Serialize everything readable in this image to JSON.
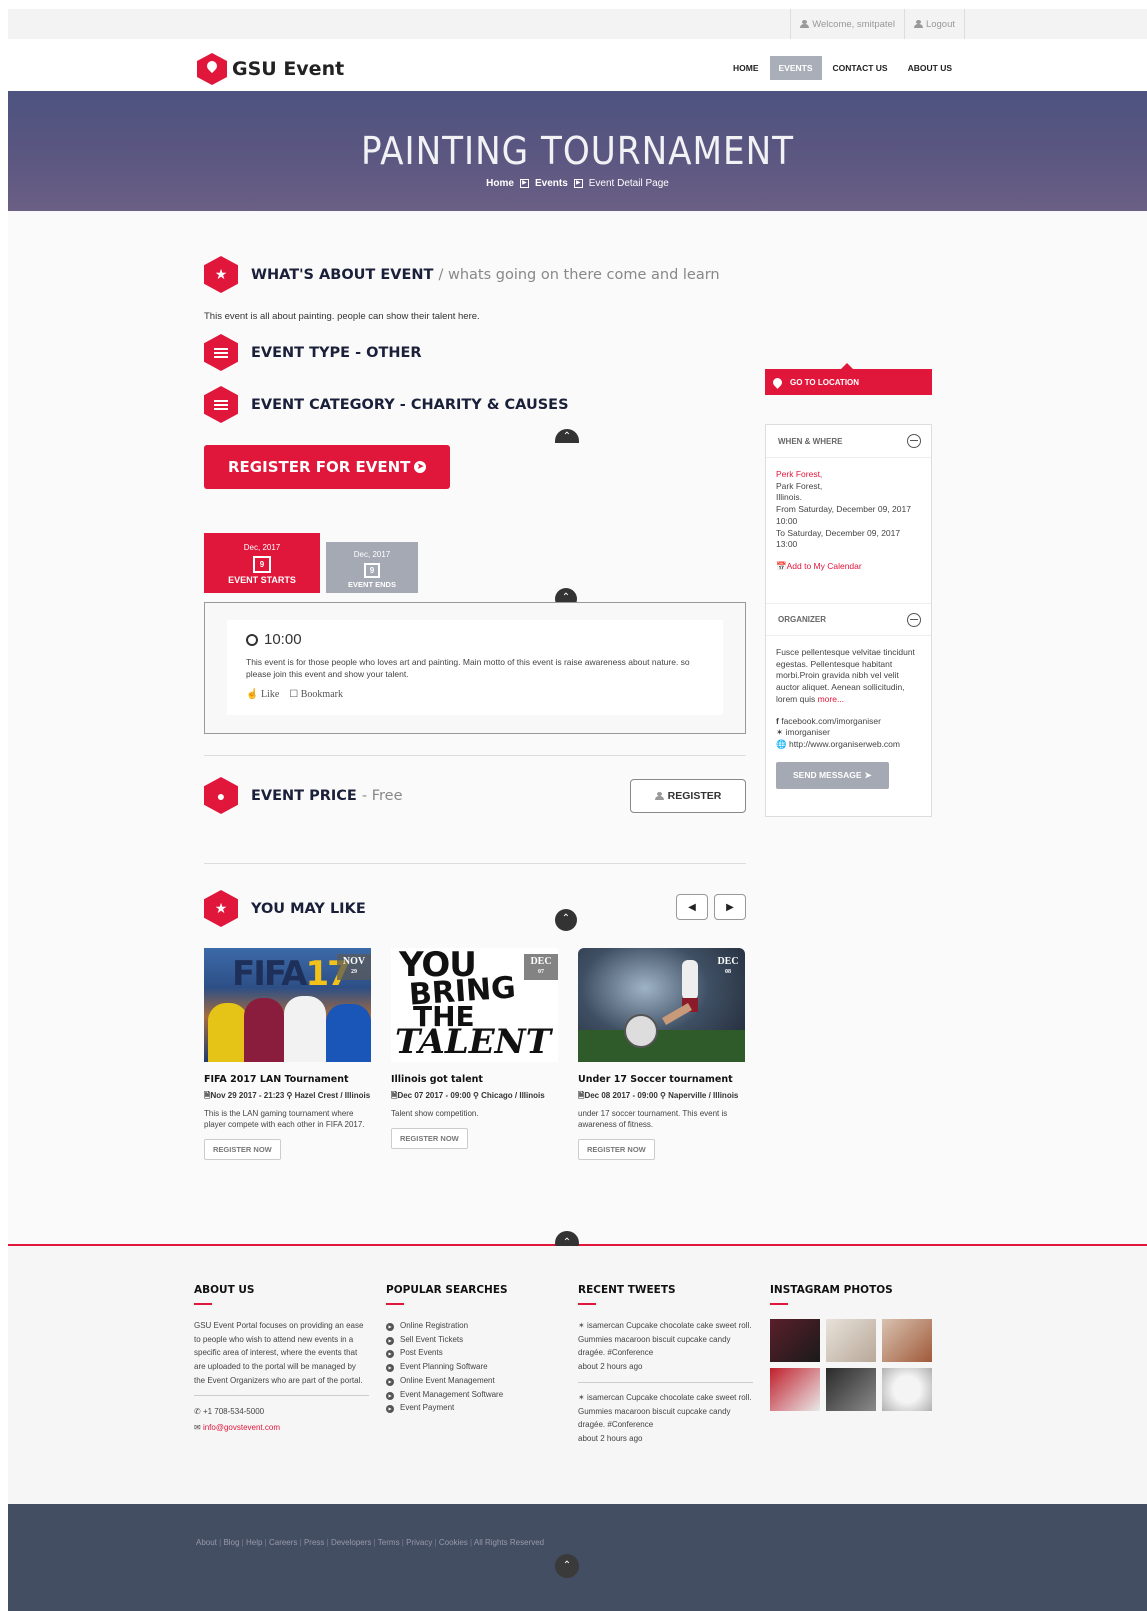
{
  "topbar": {
    "welcome": "Welcome, smitpatel",
    "logout": "Logout"
  },
  "brand": {
    "name": "GSU Event"
  },
  "nav": [
    {
      "label": "HOME"
    },
    {
      "label": "EVENTS"
    },
    {
      "label": "CONTACT US"
    },
    {
      "label": "ABOUT US"
    }
  ],
  "banner": {
    "title": "PAINTING TOURNAMENT",
    "crumb_home": "Home",
    "crumb_events": "Events",
    "crumb_current": "Event Detail Page"
  },
  "about": {
    "heading": "WHAT'S ABOUT EVENT",
    "subheading": "/ whats going on there come and learn",
    "description": "This event is all about painting. people can show their talent here."
  },
  "event_type": "EVENT TYPE - OTHER",
  "event_category": "EVENT CATEGORY - CHARITY & CAUSES",
  "register_button": "REGISTER FOR EVENT",
  "tabs": {
    "start": {
      "date": "Dec, 2017",
      "day": "9",
      "label": "EVENT STARTS"
    },
    "end": {
      "date": "Dec, 2017",
      "day": "9",
      "label": "EVENT ENDS"
    }
  },
  "schedule": {
    "time": "10:00",
    "text": "This event is for those people who loves art and painting. Main motto of this event is raise awareness about nature. so please join this event and show your talent.",
    "like": "Like",
    "bookmark": "Bookmark"
  },
  "price": {
    "label": "EVENT PRICE",
    "value": "- Free",
    "register": "REGISTER"
  },
  "you_may_like": {
    "heading": "YOU MAY LIKE",
    "cards": [
      {
        "badge_month": "NOV",
        "badge_day": "29",
        "title": "FIFA 2017 LAN Tournament",
        "meta": "Nov 29 2017 - 21:23 ⚲ Hazel Crest / Illinois",
        "desc": "This is the LAN gaming tournament where player compete with each other in FIFA 2017.",
        "button": "REGISTER NOW"
      },
      {
        "badge_month": "DEC",
        "badge_day": "07",
        "title": "Illinois got talent",
        "meta": "Dec 07 2017 - 09:00 ⚲ Chicago / Illinois",
        "desc": "Talent show competition.",
        "button": "REGISTER NOW"
      },
      {
        "badge_month": "DEC",
        "badge_day": "08",
        "title": "Under 17 Soccer tournament",
        "meta": "Dec 08 2017 - 09:00 ⚲ Naperville / Illinois",
        "desc": "under 17 soccer tournament. This event is awareness of fitness.",
        "button": "REGISTER NOW"
      }
    ]
  },
  "sidebar": {
    "location_button": "GO TO LOCATION",
    "when_where": {
      "heading": "WHEN & WHERE",
      "venue": "Perk Forest,",
      "city": "Park Forest,",
      "state": "Illinois.",
      "from": "From Saturday, December 09, 2017 10:00",
      "to": "To Saturday, December 09, 2017 13:00",
      "calendar": "Add to My Calendar"
    },
    "organizer": {
      "heading": "ORGANIZER",
      "text": "Fusce pellentesque velvitae tincidunt egestas. Pellentesque habitant morbi.Proin gravida nibh vel velit auctor aliquet. Aenean sollicitudin, lorem quis",
      "more": "more...",
      "facebook": "facebook.com/imorganiser",
      "twitter": "imorganiser",
      "website": "http://www.organiserweb.com",
      "send": "SEND MESSAGE"
    }
  },
  "footer": {
    "about": {
      "heading": "ABOUT US",
      "text": "GSU Event Portal focuses on providing an ease to people who wish to attend new events in a specific area of interest, where the events that are uploaded to the portal will be managed by the Event Organizers who are part of the portal.",
      "phone": "+1 708-534-5000",
      "email": "info@govstevent.com"
    },
    "searches": {
      "heading": "POPULAR SEARCHES",
      "items": [
        "Online Registration",
        "Sell Event Tickets",
        "Post Events",
        "Event Planning Software",
        "Online Event Management",
        "Event Management Software",
        "Event Payment"
      ]
    },
    "tweets": {
      "heading": "RECENT TWEETS",
      "items": [
        {
          "user": "isamercan",
          "text": "Cupcake chocolate cake sweet roll. Gummies macaroon biscuit cupcake candy dragée.",
          "tag": "#Conference",
          "time": "about 2 hours ago"
        },
        {
          "user": "isamercan",
          "text": "Cupcake chocolate cake sweet roll. Gummies macaroon biscuit cupcake candy dragée.",
          "tag": "#Conference",
          "time": "about 2 hours ago"
        }
      ]
    },
    "instagram": {
      "heading": "INSTAGRAM PHOTOS"
    }
  },
  "bottom_links": [
    "About",
    "Blog",
    "Help",
    "Careers",
    "Press",
    "Developers",
    "Terms",
    "Privacy",
    "Cookies",
    "All Rights Reserved"
  ],
  "colors": {
    "accent": "#e0163b",
    "navy": "#1a1f3a",
    "footer_bar": "#434e63",
    "tab_gray": "#a4a9b3"
  }
}
